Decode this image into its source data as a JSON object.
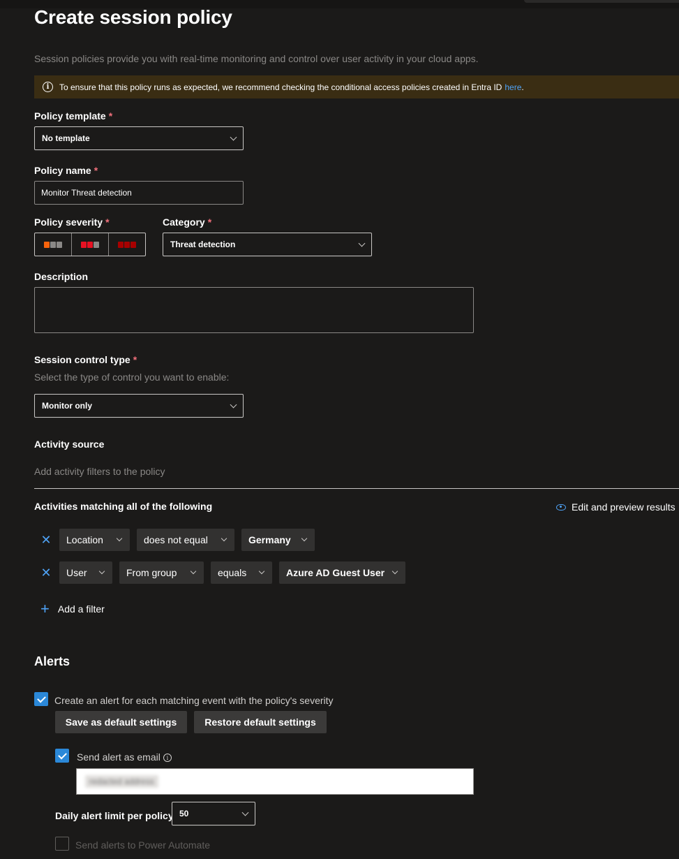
{
  "page": {
    "title": "Create session policy",
    "subtitle": "Session policies provide you with real-time monitoring and control over user activity in your cloud apps."
  },
  "banner": {
    "text": "To ensure that this policy runs as expected, we recommend checking the conditional access policies created in Entra ID",
    "link": "here",
    "end": "."
  },
  "form": {
    "template_label": "Policy template",
    "template_value": "No template",
    "name_label": "Policy name",
    "name_value": "Monitor Threat detection",
    "severity_label": "Policy severity",
    "severity_colors": {
      "low": "#f7630c",
      "medium": "#e81123",
      "high": "#a80000",
      "off": "#8a8886"
    },
    "category_label": "Category",
    "category_value": "Threat detection",
    "description_label": "Description",
    "description_value": "",
    "session_control_label": "Session control type",
    "session_control_helper": "Select the type of control you want to enable:",
    "session_control_value": "Monitor only",
    "required_mark": "*"
  },
  "activity": {
    "source_label": "Activity source",
    "source_helper": "Add activity filters to the policy",
    "matching_label": "Activities matching all of the following",
    "edit_preview": "Edit and preview results",
    "filters": [
      {
        "field": "Location",
        "op": "does not equal",
        "value": "Germany"
      },
      {
        "field": "User",
        "sub": "From group",
        "op": "equals",
        "value": "Azure AD Guest User"
      }
    ],
    "add_filter": "Add a filter"
  },
  "alerts": {
    "heading": "Alerts",
    "create_alert_label": "Create an alert for each matching event with the policy's severity",
    "create_alert_checked": true,
    "save_default": "Save as default settings",
    "restore_default": "Restore default settings",
    "email_label": "Send alert as email",
    "email_checked": true,
    "email_value": "redacted address",
    "daily_limit_label": "Daily alert limit per policy",
    "daily_limit_value": "50",
    "power_automate_label": "Send alerts to Power Automate",
    "power_automate_checked": false
  },
  "icons": {
    "info": "info-icon",
    "chevron": "chevron-down-icon",
    "remove": "close-icon",
    "add": "plus-icon",
    "eye": "eye-icon",
    "check": "checkmark-icon"
  }
}
